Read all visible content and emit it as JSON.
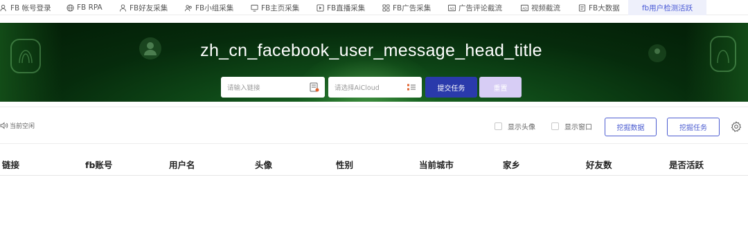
{
  "tabs": [
    {
      "label": "FB 帐号登录",
      "icon": "user-login-icon"
    },
    {
      "label": "FB RPA",
      "icon": "globe-icon"
    },
    {
      "label": "FB好友采集",
      "icon": "person-icon"
    },
    {
      "label": "FB小组采集",
      "icon": "group-icon"
    },
    {
      "label": "FB主页采集",
      "icon": "monitor-icon"
    },
    {
      "label": "FB直播采集",
      "icon": "play-icon"
    },
    {
      "label": "FB广告采集",
      "icon": "grid-icon"
    },
    {
      "label": "广告评论截流",
      "icon": "ad-icon"
    },
    {
      "label": "视频截流",
      "icon": "ad-icon"
    },
    {
      "label": "FB大数据",
      "icon": "document-icon"
    },
    {
      "label": "fb用户检测活跃",
      "icon": ""
    }
  ],
  "banner": {
    "title": "zh_cn_facebook_user_message_head_title",
    "link_placeholder": "请输入链接",
    "cloud_placeholder": "请选择AiCloud",
    "submit_label": "提交任务",
    "reset_label": "重置"
  },
  "toolbar": {
    "status_text": "当前空闲",
    "show_avatar_label": "显示头像",
    "show_window_label": "显示窗口",
    "mine_data_label": "挖掘数据",
    "mine_task_label": "挖掘任务"
  },
  "table": {
    "columns": [
      "链接",
      "fb账号",
      "用户名",
      "头像",
      "性别",
      "当前城市",
      "家乡",
      "好友数",
      "是否活跃"
    ]
  },
  "colors": {
    "accent": "#2a3aab",
    "outline_accent": "#4a5bd0",
    "reset_bg": "#d7cdf5",
    "active_tab_bg": "#eef0fb",
    "banner_green": "#0f4a18"
  }
}
